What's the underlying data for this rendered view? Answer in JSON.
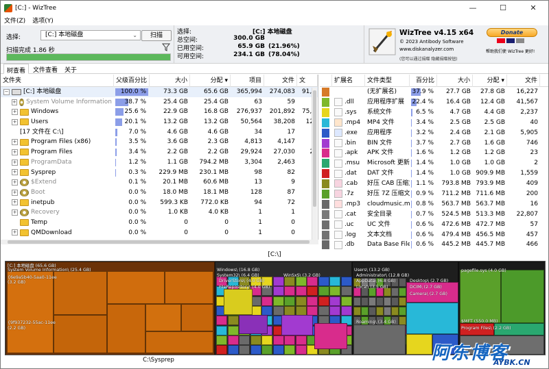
{
  "window": {
    "title": "[C:] - WizTree",
    "minimize": "—",
    "maximize": "☐",
    "close": "✕"
  },
  "menu": [
    "文件(Z)",
    "选项(Y)"
  ],
  "scan": {
    "select_label": "选择:",
    "drive": "[C:] 本地磁盘",
    "scan_button": "扫描",
    "status": "扫描完成 1.86 秒",
    "progress_percent": 100
  },
  "info": {
    "selected_label": "选择:",
    "selected_value": "[C:] 本地磁盘",
    "total_label": "总空间:",
    "total_value": "300.0 GB",
    "used_label": "已用空间:",
    "used_value": "65.9 GB",
    "used_pct": "(21.96%)",
    "free_label": "可用空间:",
    "free_value": "234.1 GB",
    "free_pct": "(78.04%)"
  },
  "about": {
    "name": "WizTree v4.15 x64",
    "copyright": "© 2023 Antibody Software",
    "site": "www.diskanalyzer.com",
    "hint": "(您可以通过捐赠 隐藏捐赠按钮)",
    "donate": "Donate",
    "donate_text": "帮助我们使 WizTree 更好!"
  },
  "tabs": [
    "树查看",
    "文件查看",
    "关于"
  ],
  "tree": {
    "columns": [
      "文件夹",
      "父级百分比",
      "大小",
      "分配",
      "项目",
      "文件",
      "文"
    ],
    "rows": [
      {
        "indent": 0,
        "expander": "−",
        "icon": "drive",
        "name": "[C:] 本地磁盘",
        "pct": "100.0 %",
        "pctv": 100,
        "size": "73.3 GB",
        "alloc": "65.6 GB",
        "items": "365,994",
        "files": "274,083",
        "extra": "91,9",
        "grey": false
      },
      {
        "indent": 1,
        "expander": "+",
        "icon": "gear",
        "name": "System Volume Information",
        "pct": "38.7 %",
        "pctv": 38.7,
        "size": "25.4 GB",
        "alloc": "25.4 GB",
        "items": "63",
        "files": "59",
        "extra": "",
        "grey": true
      },
      {
        "indent": 1,
        "expander": "+",
        "icon": "folder",
        "name": "Windows",
        "pct": "25.6 %",
        "pctv": 25.6,
        "size": "22.9 GB",
        "alloc": "16.8 GB",
        "items": "276,937",
        "files": "201,892",
        "extra": "75,0",
        "grey": false
      },
      {
        "indent": 1,
        "expander": "+",
        "icon": "folder",
        "name": "Users",
        "pct": "20.1 %",
        "pctv": 20.1,
        "size": "13.2 GB",
        "alloc": "13.2 GB",
        "items": "50,564",
        "files": "38,208",
        "extra": "12,",
        "grey": false
      },
      {
        "indent": 1,
        "expander": "",
        "icon": "none",
        "name": "[17 文件在 C:\\]",
        "pct": "7.0 %",
        "pctv": 7,
        "size": "4.6 GB",
        "alloc": "4.6 GB",
        "items": "34",
        "files": "17",
        "extra": "",
        "grey": false
      },
      {
        "indent": 1,
        "expander": "+",
        "icon": "folder",
        "name": "Program Files (x86)",
        "pct": "3.5 %",
        "pctv": 3.5,
        "size": "3.6 GB",
        "alloc": "2.3 GB",
        "items": "4,813",
        "files": "4,147",
        "extra": "6",
        "grey": false
      },
      {
        "indent": 1,
        "expander": "+",
        "icon": "folder",
        "name": "Program Files",
        "pct": "3.4 %",
        "pctv": 3.4,
        "size": "2.2 GB",
        "alloc": "2.2 GB",
        "items": "29,924",
        "files": "27,030",
        "extra": "2,",
        "grey": false
      },
      {
        "indent": 1,
        "expander": "+",
        "icon": "folder",
        "name": "ProgramData",
        "pct": "1.2 %",
        "pctv": 1.2,
        "size": "1.1 GB",
        "alloc": "794.2 MB",
        "items": "3,304",
        "files": "2,463",
        "extra": "8",
        "grey": true
      },
      {
        "indent": 1,
        "expander": "+",
        "icon": "folder",
        "name": "Sysprep",
        "pct": "0.3 %",
        "pctv": 0.3,
        "size": "229.9 MB",
        "alloc": "230.1 MB",
        "items": "98",
        "files": "82",
        "extra": "",
        "grey": false
      },
      {
        "indent": 1,
        "expander": "+",
        "icon": "gear",
        "name": "$Extend",
        "pct": "0.1 %",
        "pctv": 0.1,
        "size": "20.1 MB",
        "alloc": "60.6 MB",
        "items": "13",
        "files": "9",
        "extra": "",
        "grey": true
      },
      {
        "indent": 1,
        "expander": "+",
        "icon": "gear",
        "name": "Boot",
        "pct": "0.0 %",
        "pctv": 0,
        "size": "18.0 MB",
        "alloc": "18.1 MB",
        "items": "128",
        "files": "87",
        "extra": "",
        "grey": true
      },
      {
        "indent": 1,
        "expander": "+",
        "icon": "folder",
        "name": "inetpub",
        "pct": "0.0 %",
        "pctv": 0,
        "size": "599.3 KB",
        "alloc": "772.0 KB",
        "items": "94",
        "files": "72",
        "extra": "",
        "grey": false
      },
      {
        "indent": 1,
        "expander": "+",
        "icon": "gear",
        "name": "Recovery",
        "pct": "0.0 %",
        "pctv": 0,
        "size": "1.0 KB",
        "alloc": "4.0 KB",
        "items": "1",
        "files": "1",
        "extra": "",
        "grey": true
      },
      {
        "indent": 1,
        "expander": "",
        "icon": "folder",
        "name": "Temp",
        "pct": "0.0 %",
        "pctv": 0,
        "size": "0",
        "alloc": "0",
        "items": "1",
        "files": "0",
        "extra": "",
        "grey": false
      },
      {
        "indent": 1,
        "expander": "+",
        "icon": "folder",
        "name": "QMDownload",
        "pct": "0.0 %",
        "pctv": 0,
        "size": "0",
        "alloc": "0",
        "items": "1",
        "files": "0",
        "extra": "",
        "grey": false
      }
    ]
  },
  "ext": {
    "columns": [
      "",
      "扩展名",
      "文件类型",
      "百分比",
      "大小",
      "分配",
      "文件"
    ],
    "rows": [
      {
        "color": "#d67a28",
        "ext": "",
        "type": "(无扩展名)",
        "pct": "37.9 %",
        "pctv": 37.9,
        "size": "27.7 GB",
        "alloc": "27.8 GB",
        "files": "16,227",
        "icon": "none"
      },
      {
        "color": "#7fb82a",
        "ext": ".dll",
        "type": "应用程序扩展",
        "pct": "22.4 %",
        "pctv": 22.4,
        "size": "16.4 GB",
        "alloc": "12.4 GB",
        "files": "41,567",
        "icon": "file"
      },
      {
        "color": "#e6d61e",
        "ext": ".sys",
        "type": "系统文件",
        "pct": "6.5 %",
        "pctv": 6.5,
        "size": "4.7 GB",
        "alloc": "4.4 GB",
        "files": "2,237",
        "icon": "file"
      },
      {
        "color": "#28b8d8",
        "ext": ".mp4",
        "type": "MP4 文件",
        "pct": "3.4 %",
        "pctv": 3.4,
        "size": "2.5 GB",
        "alloc": "2.5 GB",
        "files": "40",
        "icon": "media"
      },
      {
        "color": "#2c5ac8",
        "ext": ".exe",
        "type": "应用程序",
        "pct": "3.2 %",
        "pctv": 3.2,
        "size": "2.4 GB",
        "alloc": "2.1 GB",
        "files": "5,905",
        "icon": "exe"
      },
      {
        "color": "#a23ad0",
        "ext": ".bin",
        "type": "BIN 文件",
        "pct": "3.7 %",
        "pctv": 3.7,
        "size": "2.7 GB",
        "alloc": "1.6 GB",
        "files": "746",
        "icon": "file"
      },
      {
        "color": "#d82c8c",
        "ext": ".apk",
        "type": "APK 文件",
        "pct": "1.6 %",
        "pctv": 1.6,
        "size": "1.2 GB",
        "alloc": "1.2 GB",
        "files": "23",
        "icon": "file"
      },
      {
        "color": "#2aa870",
        "ext": ".msu",
        "type": "Microsoft 更新独",
        "pct": "1.4 %",
        "pctv": 1.4,
        "size": "1.0 GB",
        "alloc": "1.0 GB",
        "files": "2",
        "icon": "file"
      },
      {
        "color": "#d02020",
        "ext": ".dat",
        "type": "DAT 文件",
        "pct": "1.4 %",
        "pctv": 1.4,
        "size": "1.0 GB",
        "alloc": "909.9 MB",
        "files": "1,559",
        "icon": "file"
      },
      {
        "color": "#8a8a20",
        "ext": ".cab",
        "type": "好压 CAB 压缩文",
        "pct": "1.1 %",
        "pctv": 1.1,
        "size": "793.8 MB",
        "alloc": "793.9 MB",
        "files": "409",
        "icon": "zip"
      },
      {
        "color": "#5aa02a",
        "ext": ".7z",
        "type": "好压 7Z 压缩文件",
        "pct": "0.9 %",
        "pctv": 0.9,
        "size": "711.2 MB",
        "alloc": "711.6 MB",
        "files": "200",
        "icon": "zip"
      },
      {
        "color": "#6a6a6a",
        "ext": ".mp3",
        "type": "cloudmusic.mp3",
        "pct": "0.8 %",
        "pctv": 0.8,
        "size": "563.7 MB",
        "alloc": "563.7 MB",
        "files": "16",
        "icon": "music"
      },
      {
        "color": "#7a7a7a",
        "ext": ".cat",
        "type": "安全目录",
        "pct": "0.7 %",
        "pctv": 0.7,
        "size": "524.5 MB",
        "alloc": "513.3 MB",
        "files": "22,807",
        "icon": "file"
      },
      {
        "color": "#6e6e6e",
        "ext": ".uc",
        "type": "UC 文件",
        "pct": "0.6 %",
        "pctv": 0.6,
        "size": "472.6 MB",
        "alloc": "472.7 MB",
        "files": "57",
        "icon": "file"
      },
      {
        "color": "#727272",
        "ext": ".log",
        "type": "文本文档",
        "pct": "0.6 %",
        "pctv": 0.6,
        "size": "479.4 MB",
        "alloc": "456.5 MB",
        "files": "457",
        "icon": "file"
      },
      {
        "color": "#686868",
        "ext": ".db",
        "type": "Data Base File",
        "pct": "0.6 %",
        "pctv": 0.6,
        "size": "445.2 MB",
        "alloc": "445.7 MB",
        "files": "466",
        "icon": "file"
      }
    ]
  },
  "path_label": "[C:\\]",
  "bottom_label": "C:\\Sysprep",
  "treemap_labels": [
    "[C:] 本地磁盘 (65.6 GB)",
    "System Volume Information\\ (25.4 GB)",
    "{6e9a5b40-5aa0-11ee",
    "(3.2 GB)",
    "{9f937232-55ac-11ee",
    "(2.2 GB)",
    "Windows\\ (16.8 GB)",
    "System32\\ (6.4 GB)",
    "DriverStore\\ (4.0 GB)",
    "FileRepository\\ (4.0 GB)",
    "WinSxS\\ (3.2 GB)",
    "Users\\ (13.2 GB)",
    "Administrator\\ (12.8 GB)",
    "AppData\\ (6.8 GB)",
    "Local\\ (3.5 GB)",
    "Roaming\\ (3.4 GB)",
    "Desktop\\ (2.7 GB)",
    "DCIM\\ (2.7 GB)",
    "Camera\\ (2.7 GB)",
    "pagefile.sys (4.0 GB)",
    "$MFT (550.0 MB)",
    "Program Files\\ (2.2 GB)"
  ],
  "watermark": {
    "big": "阿东博客",
    "small": "AYBK.CN"
  }
}
